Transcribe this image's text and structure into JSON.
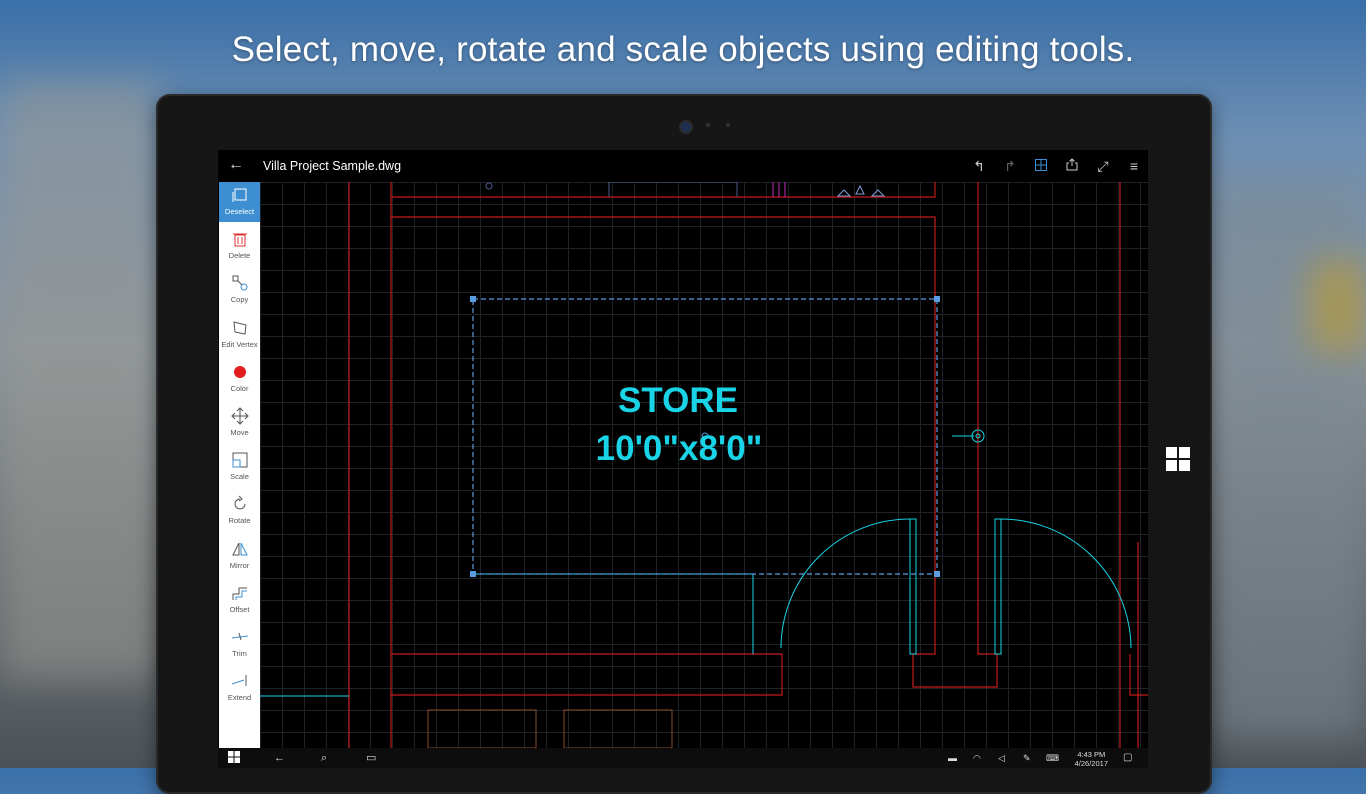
{
  "headline": "Select, move, rotate and scale objects using editing tools.",
  "app": {
    "filename": "Villa Project Sample.dwg",
    "titlebar_icons": [
      "back-arrow-icon",
      "undo-icon",
      "redo-icon",
      "grid-icon",
      "share-icon",
      "fullscreen-icon",
      "menu-icon"
    ]
  },
  "tools": [
    {
      "label": "Deselect",
      "icon": "deselect-icon",
      "active": true
    },
    {
      "label": "Delete",
      "icon": "trash-icon"
    },
    {
      "label": "Copy",
      "icon": "copy-icon"
    },
    {
      "label": "Edit Vertex",
      "icon": "edit-vertex-icon"
    },
    {
      "label": "Color",
      "icon": "color-dot-icon"
    },
    {
      "label": "Move",
      "icon": "move-icon"
    },
    {
      "label": "Scale",
      "icon": "scale-icon"
    },
    {
      "label": "Rotate",
      "icon": "rotate-icon"
    },
    {
      "label": "Mirror",
      "icon": "mirror-icon"
    },
    {
      "label": "Offset",
      "icon": "offset-icon"
    },
    {
      "label": "Trim",
      "icon": "trim-icon"
    },
    {
      "label": "Extend",
      "icon": "extend-icon"
    }
  ],
  "drawing": {
    "room_name": "STORE",
    "room_size": "10'0\"x8'0\""
  },
  "taskbar": {
    "time": "4:43 PM",
    "date": "4/26/2017"
  },
  "colors": {
    "accent": "#3d8fd1",
    "walls": "#c41a1a",
    "cyan": "#19d4e6",
    "selection": "#5b9be0"
  }
}
